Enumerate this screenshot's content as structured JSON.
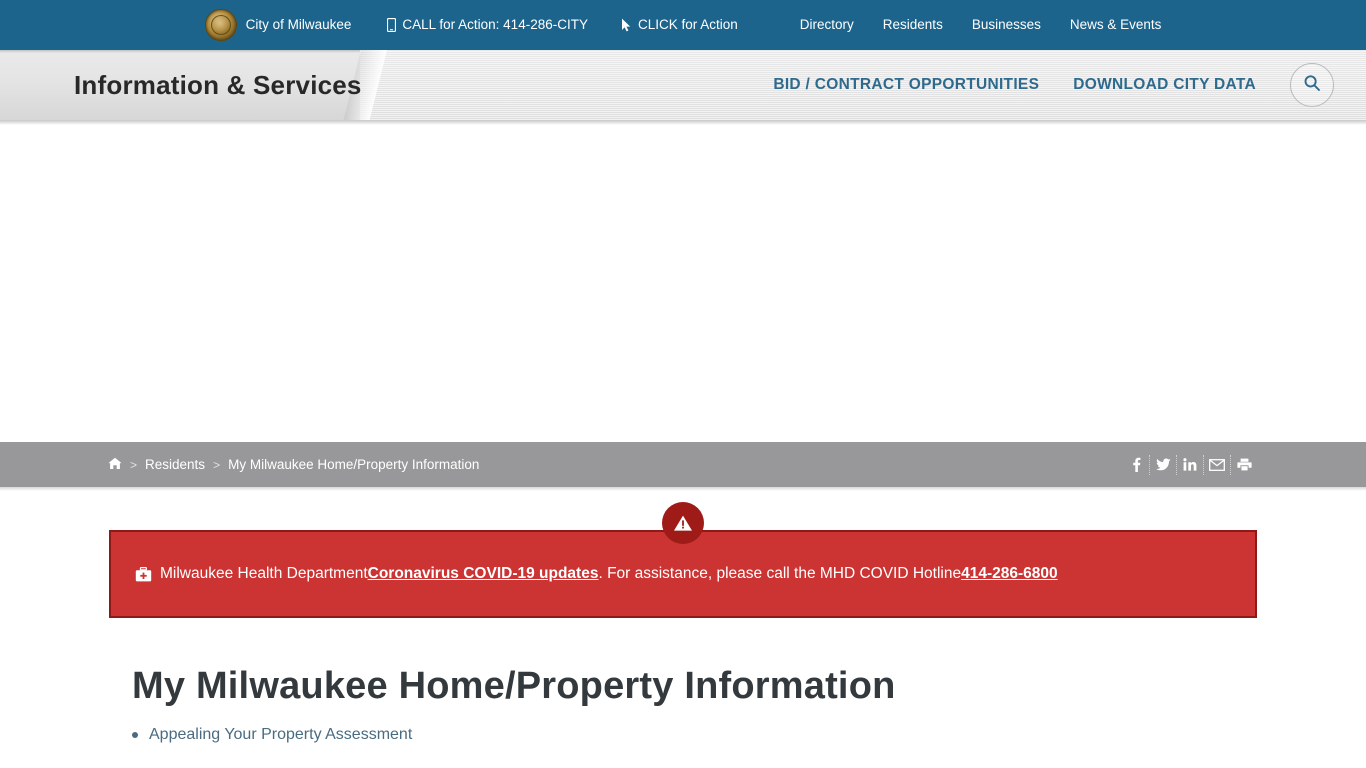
{
  "topbar": {
    "brand": "City of Milwaukee",
    "items": [
      {
        "label": "CALL for Action: 414-286-CITY",
        "icon": "mobile-phone-icon"
      },
      {
        "label": "CLICK for Action",
        "icon": "cursor-pointer-icon"
      }
    ],
    "nav": [
      {
        "label": "Directory"
      },
      {
        "label": "Residents"
      },
      {
        "label": "Businesses"
      },
      {
        "label": "News & Events"
      }
    ],
    "background_color": "#1c648c",
    "logo_icon": "city-seal-icon"
  },
  "header": {
    "title": "Information & Services",
    "links": [
      {
        "label": "BID / CONTRACT OPPORTUNITIES"
      },
      {
        "label": "DOWNLOAD CITY DATA"
      }
    ],
    "search_icon": "search-icon",
    "link_color": "#2d6a8e"
  },
  "breadcrumb": {
    "home_icon": "home-icon",
    "separator": ">",
    "items": [
      {
        "label": "Residents",
        "current": false
      },
      {
        "label": "My Milwaukee Home/Property Information",
        "current": true
      }
    ],
    "background_color": "#98989a",
    "social": [
      {
        "icon": "facebook-icon",
        "label": "f"
      },
      {
        "icon": "twitter-icon",
        "label": "t"
      },
      {
        "icon": "linkedin-icon",
        "label": "in"
      },
      {
        "icon": "email-icon",
        "label": "mail"
      },
      {
        "icon": "print-icon",
        "label": "print"
      }
    ]
  },
  "alert": {
    "badge_icon": "warning-triangle-icon",
    "kit_icon": "medical-kit-icon",
    "text_before": "Milwaukee Health Department ",
    "link_label": "Coronavirus COVID-19 updates",
    "text_middle": ". For assistance, please call the MHD COVID Hotline ",
    "phone": "414-286-6800",
    "background_color": "#cc3333",
    "border_color": "#8e1a17",
    "badge_color": "#9e1b18"
  },
  "main": {
    "title": "My Milwaukee Home/Property Information",
    "links": [
      {
        "label": "Appealing Your Property Assessment"
      }
    ],
    "link_color": "#4a6b80"
  }
}
